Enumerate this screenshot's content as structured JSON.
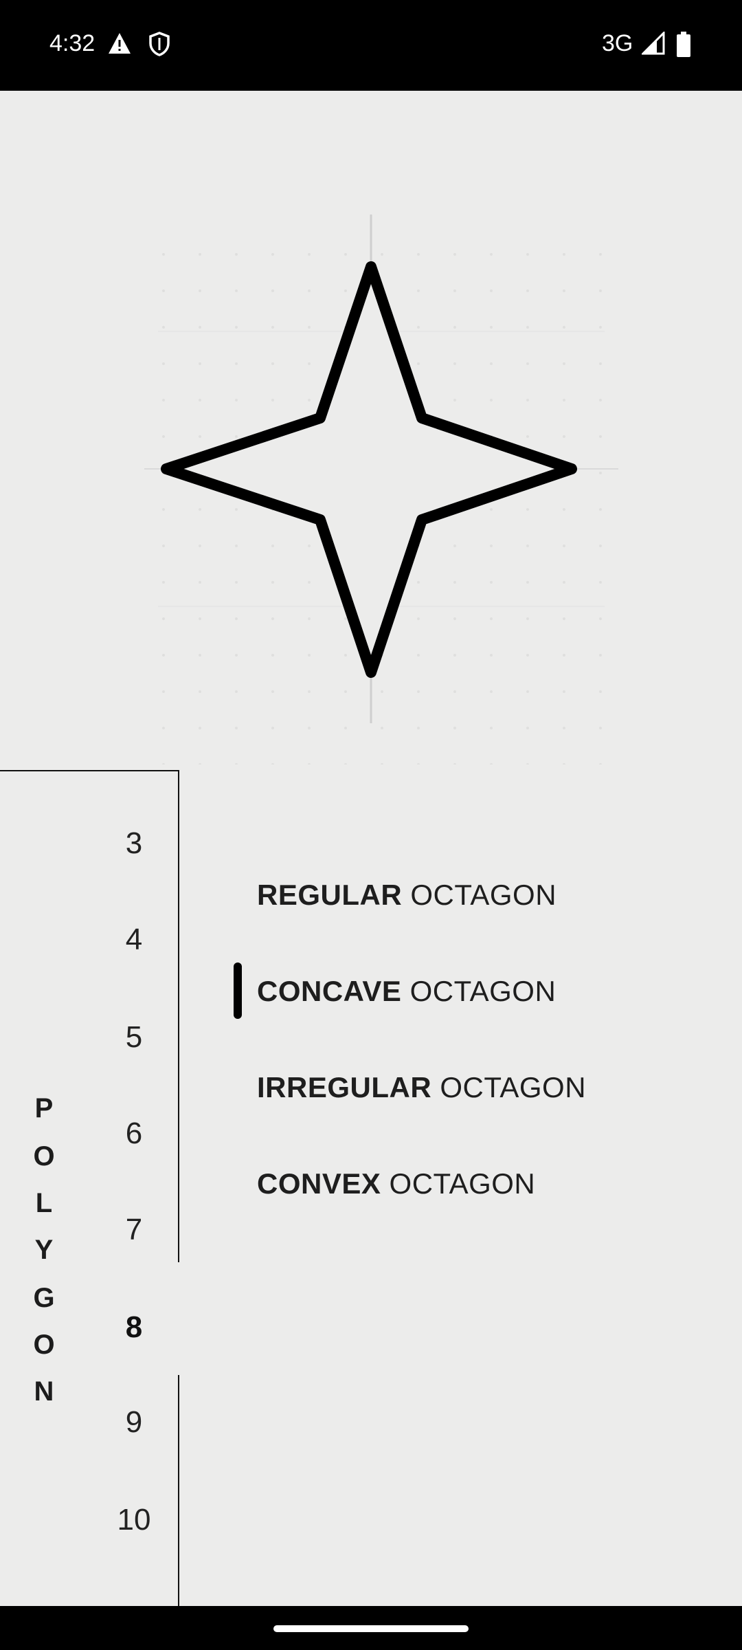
{
  "status_bar": {
    "time": "4:32",
    "network": "3G",
    "icons": [
      "warning-icon",
      "shield-icon",
      "signal-icon",
      "battery-icon"
    ]
  },
  "shape": {
    "name": "star-outline",
    "stroke_color": "#000000",
    "fill_color": "#ececeb"
  },
  "sidebar": {
    "title_letters": [
      "P",
      "O",
      "L",
      "Y",
      "G",
      "O",
      "N"
    ],
    "numbers": [
      "3",
      "4",
      "5",
      "6",
      "7",
      "8",
      "9",
      "10"
    ],
    "selected": "8"
  },
  "types": [
    {
      "bold": "REGULAR",
      "rest": " OCTAGON"
    },
    {
      "bold": "CONCAVE",
      "rest": " OCTAGON"
    },
    {
      "bold": "IRREGULAR",
      "rest": " OCTAGON"
    },
    {
      "bold": "CONVEX",
      "rest": " OCTAGON"
    }
  ],
  "selected_type": "CONCAVE"
}
